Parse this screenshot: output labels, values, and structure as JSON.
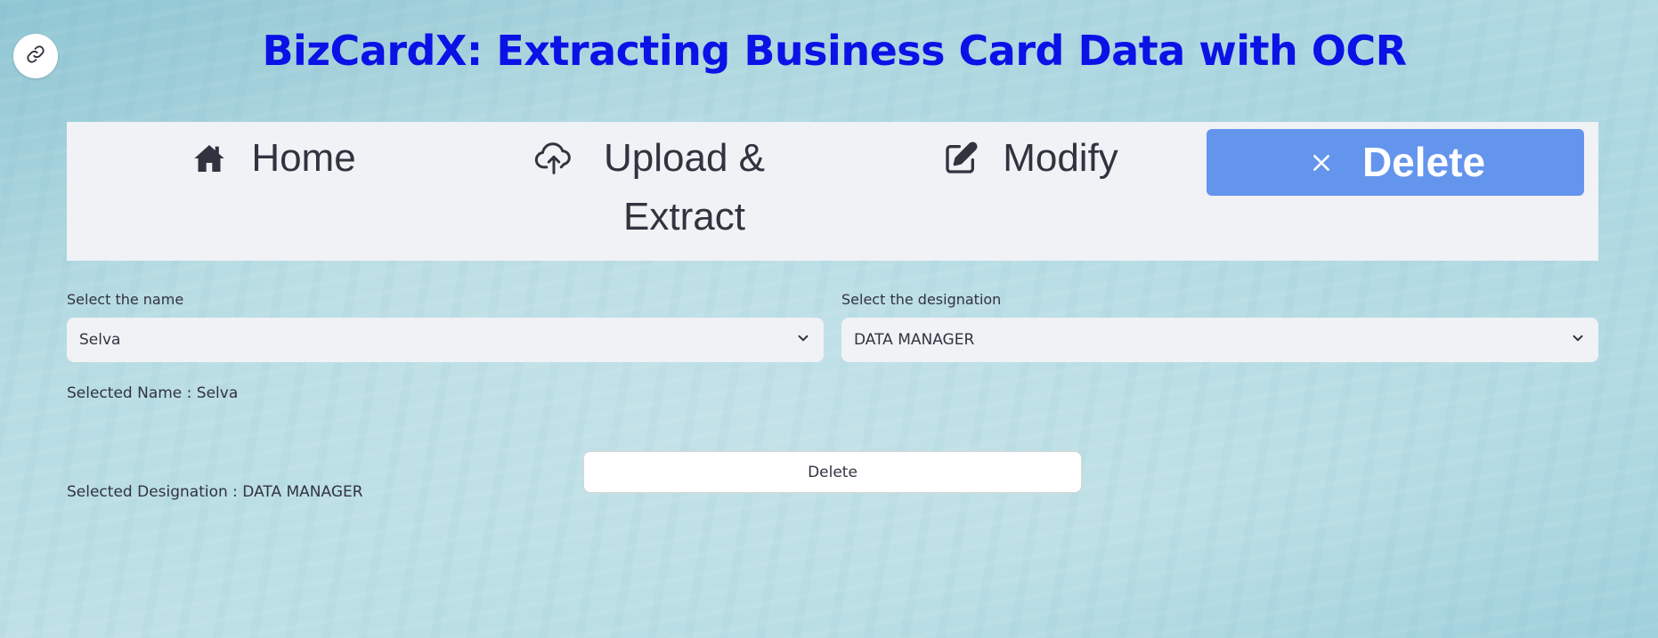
{
  "page": {
    "title": "BizCardX: Extracting Business Card Data with OCR"
  },
  "nav": {
    "items": [
      {
        "label": "Home",
        "icon": "home-icon"
      },
      {
        "label": "Upload & Extract",
        "icon": "cloud-upload-icon"
      },
      {
        "label": "Modify",
        "icon": "edit-icon"
      },
      {
        "label": "Delete",
        "icon": "close-icon",
        "selected": true
      }
    ]
  },
  "form": {
    "name_label": "Select the name",
    "name_value": "Selva",
    "designation_label": "Select the designation",
    "designation_value": "DATA MANAGER"
  },
  "info": {
    "selected_name": "Selected Name : Selva",
    "selected_designation": "Selected Designation : DATA MANAGER"
  },
  "actions": {
    "delete_label": "Delete"
  },
  "colors": {
    "title": "#0a12e6",
    "nav_bg": "#f0f2f6",
    "selected_tab": "#6495ed",
    "text": "#31333f"
  }
}
